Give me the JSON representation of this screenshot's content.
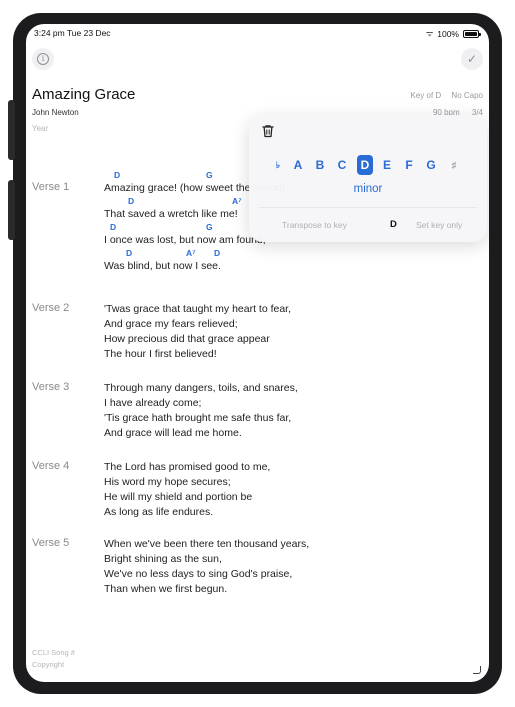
{
  "status_bar": {
    "time": "3:24 pm  Tue 23 Dec",
    "battery": "100%"
  },
  "song": {
    "title": "Amazing Grace",
    "author": "John Newton",
    "year_placeholder": "Year",
    "key": "Key of D",
    "capo": "No Capo",
    "tempo": "90 bpm",
    "time_signature": "3/4"
  },
  "verses": [
    {
      "label": "Verse 1",
      "lines": [
        {
          "text": "Amazing grace! (how sweet the sound)",
          "chords": [
            "D",
            "G"
          ]
        },
        {
          "text": "That saved a wretch like me!",
          "chords": [
            "D",
            "A⁷"
          ]
        },
        {
          "text": "I once was lost, but now am found,",
          "chords": [
            "D",
            "G"
          ]
        },
        {
          "text": "Was blind, but now I see.",
          "chords": [
            "D",
            "A⁷",
            "D"
          ]
        }
      ]
    },
    {
      "label": "Verse 2",
      "lines": [
        {
          "text": "'Twas grace that taught my heart to fear,"
        },
        {
          "text": "And grace my fears relieved;"
        },
        {
          "text": "How precious did that grace appear"
        },
        {
          "text": "The hour I first believed!"
        }
      ]
    },
    {
      "label": "Verse 3",
      "lines": [
        {
          "text": "Through many dangers, toils, and snares,"
        },
        {
          "text": "I have already come;"
        },
        {
          "text": "'Tis grace hath brought me safe thus far,"
        },
        {
          "text": "And grace will lead me home."
        }
      ]
    },
    {
      "label": "Verse 4",
      "lines": [
        {
          "text": "The Lord has promised good to me,"
        },
        {
          "text": "His word my hope secures;"
        },
        {
          "text": "He will my shield and portion be"
        },
        {
          "text": "As long as life endures."
        }
      ]
    },
    {
      "label": "Verse 5",
      "lines": [
        {
          "text": "When we've been there ten thousand years,"
        },
        {
          "text": "Bright shining as the sun,"
        },
        {
          "text": "We've no less days to sing God's praise,"
        },
        {
          "text": "Than when we first begun."
        }
      ]
    }
  ],
  "footer": {
    "ccli": "CCLI Song #",
    "copyright": "Copyright"
  },
  "key_picker": {
    "flat": "♭",
    "sharp": "♯",
    "notes": [
      "A",
      "B",
      "C",
      "D",
      "E",
      "F",
      "G"
    ],
    "selected_note": "D",
    "minor_label": "minor",
    "transpose_label": "Transpose to key",
    "transpose_value": "D",
    "set_key_only_label": "Set key only"
  },
  "icons": {
    "info": "info-icon",
    "done": "checkmark-icon",
    "trash": "trash-icon",
    "wifi": "wifi-icon",
    "battery": "battery-icon"
  },
  "colors": {
    "accent": "#2a6bd6",
    "chord": "#2a6bd6",
    "muted": "#8a8a8e"
  }
}
